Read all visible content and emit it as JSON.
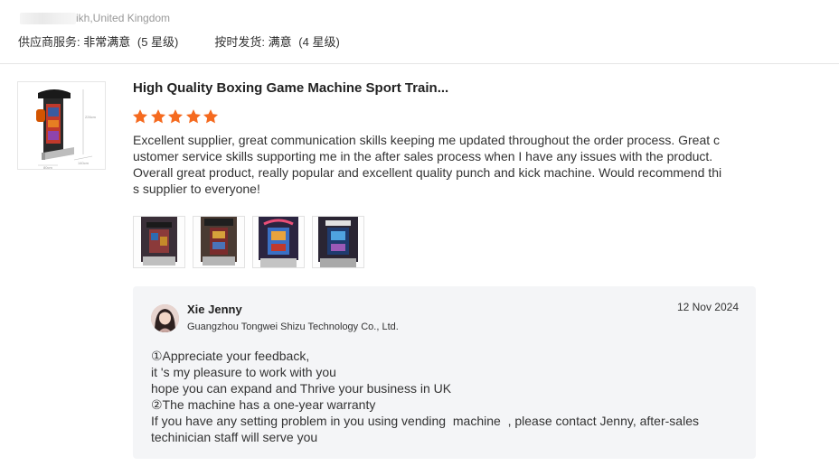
{
  "reviewer": {
    "location": "ikh,United Kingdom"
  },
  "ratings": [
    {
      "label": "供应商服务:",
      "value": "非常满意",
      "sub": "(5 星级)"
    },
    {
      "label": "按时发货:",
      "value": "满意",
      "sub": "(4 星级)"
    }
  ],
  "product": {
    "title": "High Quality Boxing Game Machine Sport Train...",
    "thumb_icon": "boxing-machine-image"
  },
  "review": {
    "stars": 5,
    "star_color": "#f56a1f",
    "text": "Excellent supplier, great communication skills keeping me updated throughout the order process. Great customer service skills supporting me in the after sales process when I have any issues with the product. Overall great product, really popular and excellent quality punch and kick machine. Would recommend this supplier to everyone!"
  },
  "gallery": [
    {
      "icon": "review-photo-1"
    },
    {
      "icon": "review-photo-2"
    },
    {
      "icon": "review-photo-3"
    },
    {
      "icon": "review-photo-4"
    }
  ],
  "reply": {
    "name": "Xie Jenny",
    "company": "Guangzhou Tongwei Shizu Technology Co., Ltd.",
    "date": "12 Nov 2024",
    "lines": [
      "①Appreciate your feedback,",
      "it 's my pleasure to work with you",
      "hope you can expand and Thrive your business in UK",
      "②The machine has a one-year warranty",
      "If you have any setting problem in you using vending  machine  , please contact Jenny, after-sales",
      "techinician staff will serve you"
    ]
  }
}
